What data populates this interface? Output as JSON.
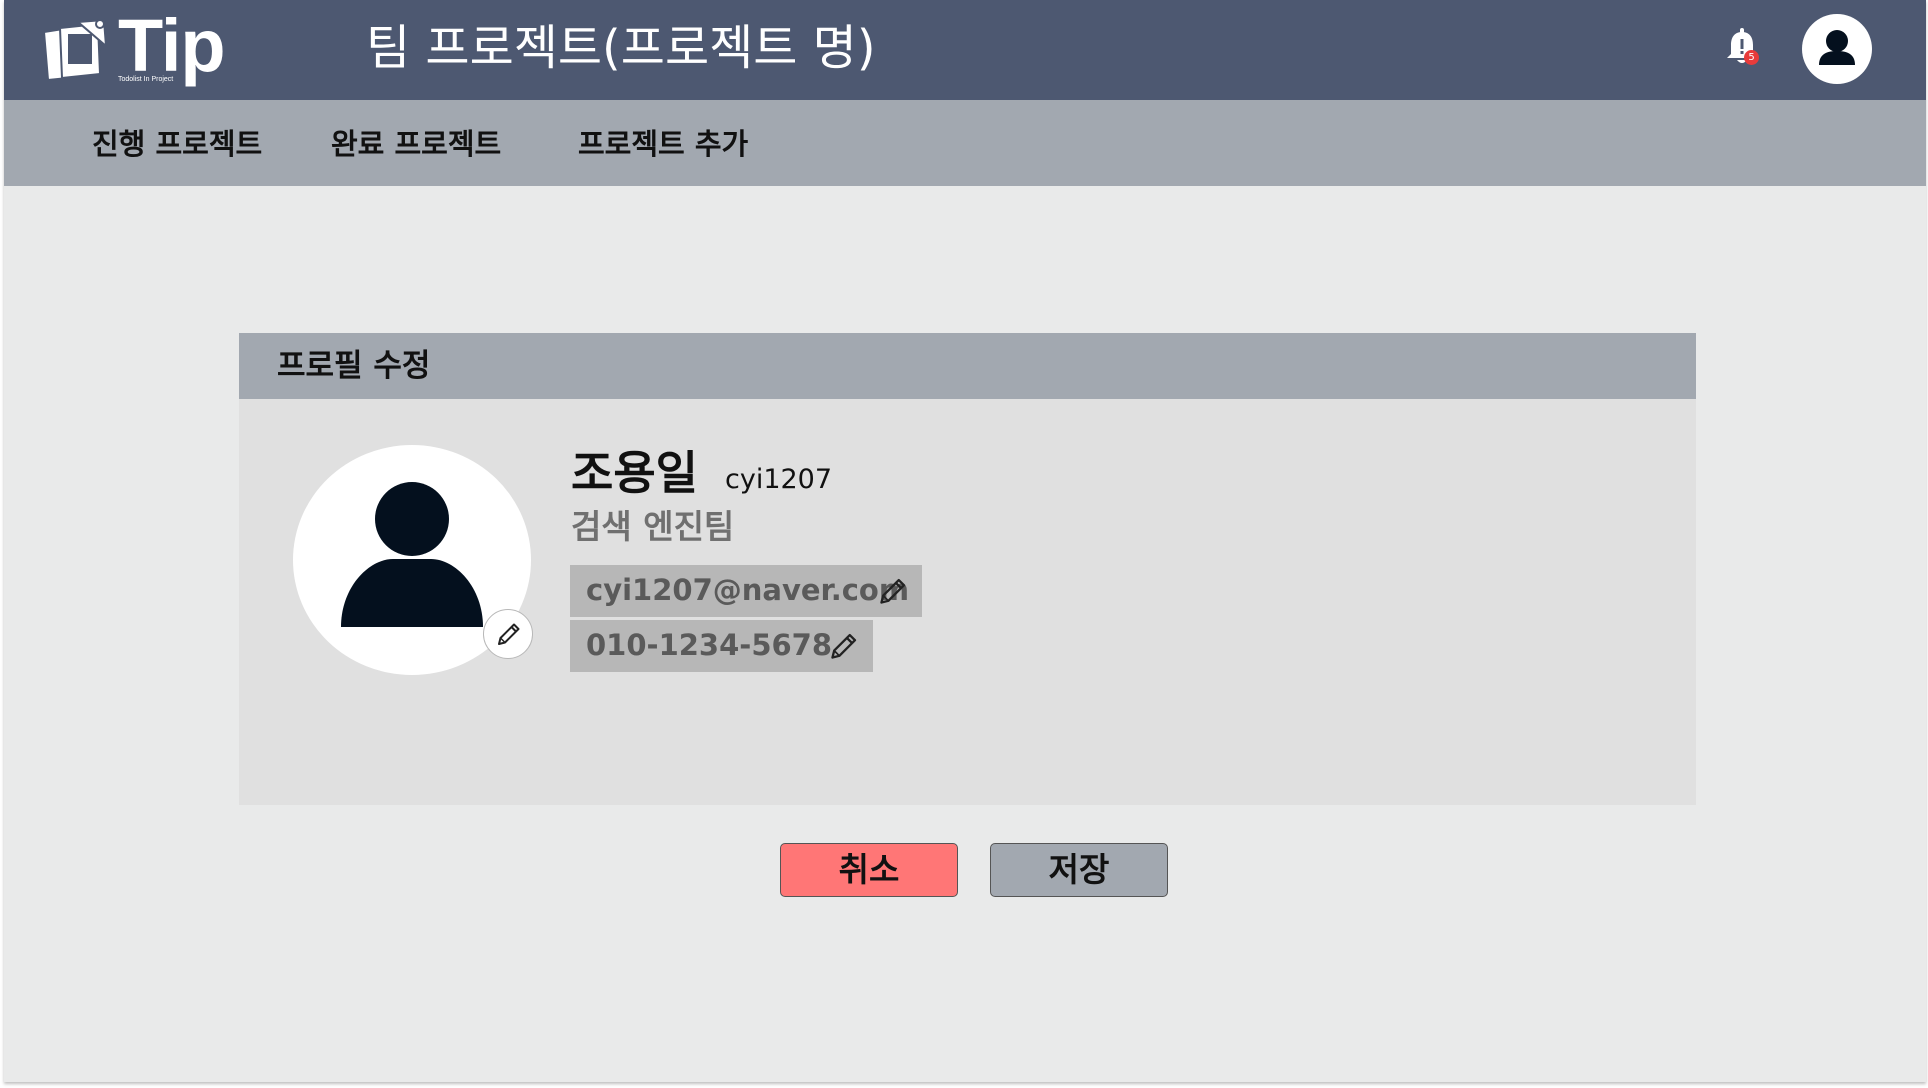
{
  "header": {
    "logo_text": "Tip",
    "logo_subtitle": "Todolist In Project",
    "title": "팀 프로젝트(프로젝트 명)",
    "notification_count": "5",
    "icons": {
      "notification": "bell-icon",
      "account": "user-avatar-icon"
    }
  },
  "nav": {
    "items": [
      {
        "label": "진행 프로젝트"
      },
      {
        "label": "완료 프로젝트"
      },
      {
        "label": "프로젝트 추가"
      }
    ]
  },
  "profile": {
    "section_title": "프로필 수정",
    "name": "조용일",
    "user_id": "cyi1207",
    "team": "검색 엔진팀",
    "email": "cyi1207@naver.com",
    "phone": "010-1234-5678",
    "icons": {
      "photo": "user-avatar-icon",
      "edit": "pencil-icon"
    }
  },
  "actions": {
    "cancel_label": "취소",
    "save_label": "저장"
  },
  "colors": {
    "header_bg": "#4d5871",
    "nav_bg": "#a2a8b0",
    "page_bg": "#e9eaea",
    "card_bg": "#e0e0e0",
    "field_bg": "#b7b7b7",
    "cancel_bg": "#ff7676",
    "save_bg": "#a2a8b0",
    "badge": "#e83b3b",
    "avatar_fill": "#04101e"
  }
}
